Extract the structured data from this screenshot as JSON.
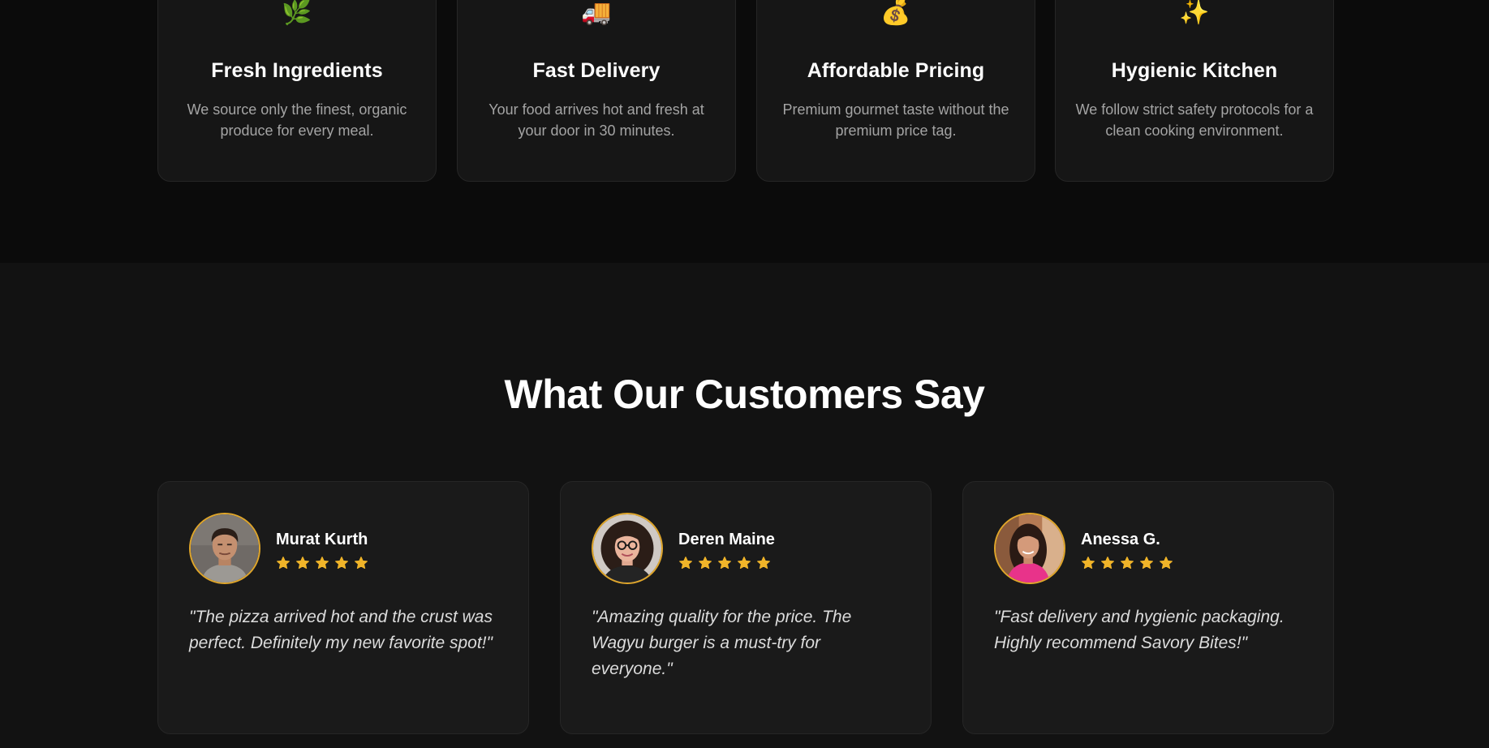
{
  "features": [
    {
      "icon": "herb-icon",
      "glyph": "🌿",
      "title": "Fresh Ingredients",
      "description": "We source only the finest, organic produce for every meal."
    },
    {
      "icon": "delivery-truck-icon",
      "glyph": "🚚",
      "title": "Fast Delivery",
      "description": "Your food arrives hot and fresh at your door in 30 minutes."
    },
    {
      "icon": "money-bag-icon",
      "glyph": "💰",
      "title": "Affordable Pricing",
      "description": "Premium gourmet taste without the premium price tag."
    },
    {
      "icon": "sparkles-icon",
      "glyph": "✨",
      "title": "Hygienic Kitchen",
      "description": "We follow strict safety protocols for a clean cooking environment."
    }
  ],
  "reviews": {
    "heading": "What Our Customers Say",
    "rating_color": "#f0b429",
    "accent": "#e0a62a",
    "items": [
      {
        "name": "Murat Kurth",
        "rating": 5,
        "text": "\"The pizza arrived hot and the crust was perfect. Definitely my new favorite spot!\""
      },
      {
        "name": "Deren Maine",
        "rating": 5,
        "text": "\"Amazing quality for the price. The Wagyu burger is a must-try for everyone.\""
      },
      {
        "name": "Anessa G.",
        "rating": 5,
        "text": "\"Fast delivery and hygienic packaging. Highly recommend Savory Bites!\""
      }
    ]
  }
}
